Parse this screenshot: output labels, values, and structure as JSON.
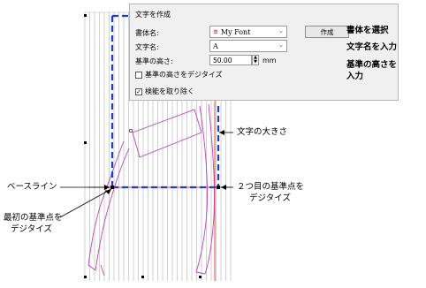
{
  "dialog": {
    "title": "文字を作成",
    "font_label": "書体名:",
    "font_value": "My Font",
    "font_icon": "font-stitch-icon",
    "create_button": "作成",
    "letters_label": "文字名:",
    "letters_value": "A",
    "height_label": "基準の高さ:",
    "height_value": "50.00",
    "height_unit": "mm",
    "digitize_height_label": "基準の高さをデジタイズ",
    "digitize_height_checked": false,
    "remove_overlap_label": "検能を取り除く",
    "remove_overlap_checked": true
  },
  "callouts": {
    "select_font": "書体を選択",
    "enter_letter": "文字名を入力",
    "enter_height_line1": "基準の高さを",
    "enter_height_line2": "入力",
    "letter_size": "文字の大きさ",
    "baseline": "ベースライン",
    "second_point_line1": "２つ目の基準点を",
    "second_point_line2": "デジタイズ",
    "first_point_line1": "最初の基準点を",
    "first_point_line2": "デジタイズ"
  },
  "colors": {
    "guide_blue": "#1f3fbf",
    "grid_gray": "#b4b4b4",
    "baseline_red": "#e03a3a",
    "outline_magenta": "#c040c0"
  }
}
